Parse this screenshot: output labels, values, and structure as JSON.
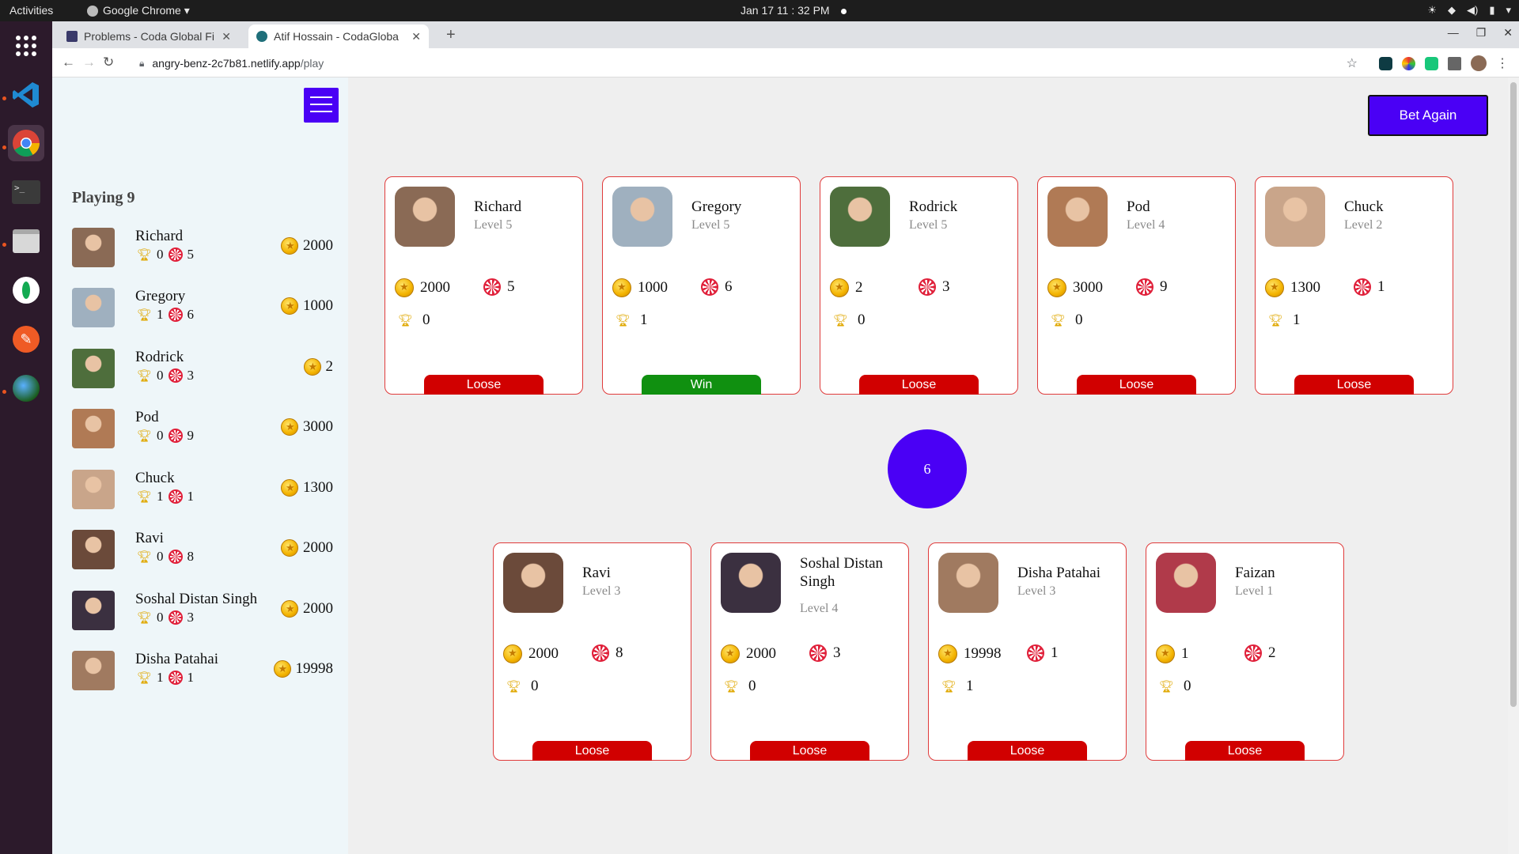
{
  "topbar": {
    "activities": "Activities",
    "app": "Google Chrome ▾",
    "clock": "Jan 17  11 : 32 PM"
  },
  "browser": {
    "tabs": [
      {
        "label": "Problems - Coda Global Fi",
        "close": "✕"
      },
      {
        "label": "Atif Hossain - CodaGloba",
        "close": "✕"
      }
    ],
    "new_tab": "+",
    "url_host": "angry-benz-2c7b81.netlify.app",
    "url_path": "/play"
  },
  "sidebar": {
    "playing_label": "Playing 9",
    "players": [
      {
        "name": "Richard",
        "trophies": "0",
        "bets": "5",
        "coins": "2000",
        "avatar_color": "#8a6a55"
      },
      {
        "name": "Gregory",
        "trophies": "1",
        "bets": "6",
        "coins": "1000",
        "avatar_color": "#9fb0bf"
      },
      {
        "name": "Rodrick",
        "trophies": "0",
        "bets": "3",
        "coins": "2",
        "avatar_color": "#4e6e3c"
      },
      {
        "name": "Pod",
        "trophies": "0",
        "bets": "9",
        "coins": "3000",
        "avatar_color": "#b07a55"
      },
      {
        "name": "Chuck",
        "trophies": "1",
        "bets": "1",
        "coins": "1300",
        "avatar_color": "#c9a58a"
      },
      {
        "name": "Ravi",
        "trophies": "0",
        "bets": "8",
        "coins": "2000",
        "avatar_color": "#6b4a3a"
      },
      {
        "name": "Soshal Distan Singh",
        "trophies": "0",
        "bets": "3",
        "coins": "2000",
        "avatar_color": "#3b3040"
      },
      {
        "name": "Disha Patahai",
        "trophies": "1",
        "bets": "1",
        "coins": "19998",
        "avatar_color": "#a07a60"
      }
    ]
  },
  "main": {
    "bet_again": "Bet Again",
    "drawn_number": "6",
    "cards": [
      {
        "name": "Richard",
        "level": "Level 5",
        "coins": "2000",
        "bets": "5",
        "trophies": "0",
        "result": "Loose"
      },
      {
        "name": "Gregory",
        "level": "Level 5",
        "coins": "1000",
        "bets": "6",
        "trophies": "1",
        "result": "Win"
      },
      {
        "name": "Rodrick",
        "level": "Level 5",
        "coins": "2",
        "bets": "3",
        "trophies": "0",
        "result": "Loose"
      },
      {
        "name": "Pod",
        "level": "Level 4",
        "coins": "3000",
        "bets": "9",
        "trophies": "0",
        "result": "Loose"
      },
      {
        "name": "Chuck",
        "level": "Level 2",
        "coins": "1300",
        "bets": "1",
        "trophies": "1",
        "result": "Loose"
      },
      {
        "name": "Ravi",
        "level": "Level 3",
        "coins": "2000",
        "bets": "8",
        "trophies": "0",
        "result": "Loose"
      },
      {
        "name": "Soshal Distan Singh",
        "level": "Level 4",
        "coins": "2000",
        "bets": "3",
        "trophies": "0",
        "result": "Loose"
      },
      {
        "name": "Disha Patahai",
        "level": "Level 3",
        "coins": "19998",
        "bets": "1",
        "trophies": "1",
        "result": "Loose"
      },
      {
        "name": "Faizan",
        "level": "Level 1",
        "coins": "1",
        "bets": "2",
        "trophies": "0",
        "result": "Loose"
      }
    ]
  },
  "colors": {
    "accent": "#4a00f5",
    "loose": "#d10000",
    "win": "#109010",
    "card_border": "#e03b3b"
  }
}
